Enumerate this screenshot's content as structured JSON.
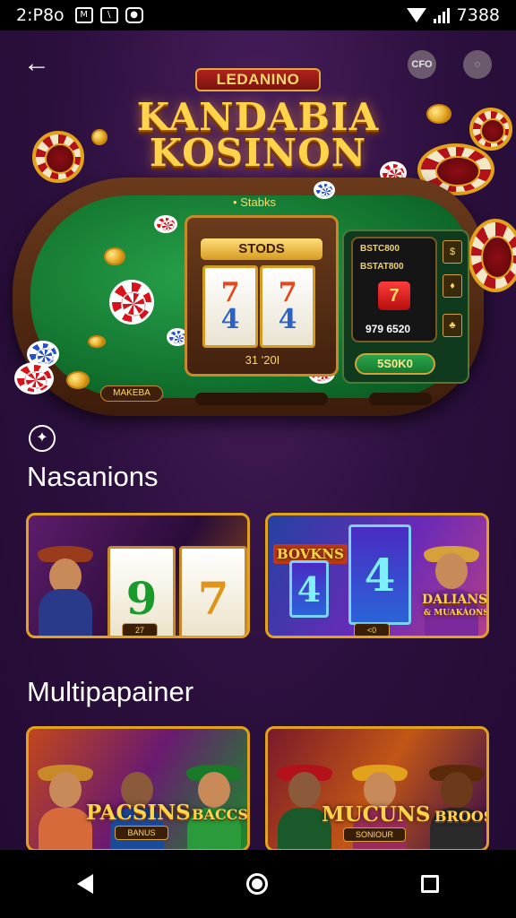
{
  "status_bar": {
    "time": "2:P8o",
    "icon_1": "M",
    "battery_text": "7388",
    "icons": [
      "msg-icon",
      "sim-icon",
      "camera-icon",
      "wifi-icon",
      "signal-icon"
    ]
  },
  "header": {
    "back_icon": "←",
    "top_button_1": "CFO",
    "top_button_2": "◌",
    "brand_subtitle": "LEDANINO",
    "brand_title_line1": "KANDABIA",
    "brand_title_line2": "KOSINON"
  },
  "table": {
    "felt_label": "• Stabks",
    "slot_header": "STODS",
    "reel_1": [
      "7",
      "4"
    ],
    "reel_2": [
      "7",
      "4"
    ],
    "slot_footer": "31 '20I",
    "panel_line1": "BSTC800",
    "panel_line2": "BSTAT800",
    "panel_bet": "7",
    "panel_value": "979 6520",
    "panel_symbols": [
      "$",
      "♦",
      "♣"
    ],
    "panel_balance": "5S0K0",
    "rail_badge": "MAKEBA"
  },
  "sections": [
    {
      "icon": "✦",
      "title": "Nasanions",
      "cards": [
        {
          "reel_a": "9",
          "reel_b": "7",
          "badge": "27"
        },
        {
          "label_left": "BOVKNS",
          "reel_a": "4",
          "reel_b": "4",
          "label_right": "DALIANS",
          "label_right_sub": "& MUAKÁONS",
          "badge": "<0"
        }
      ]
    },
    {
      "title": "Multipapainer",
      "cards": [
        {
          "label": "PACSINS",
          "label_extra": "BACCS",
          "sub": "BANUS"
        },
        {
          "label": "MUCUNS",
          "label_extra": "BROOS",
          "sub": "SONIOUR"
        }
      ]
    }
  ],
  "colors": {
    "background": "#2a0f3a",
    "gold": "#e3a21c",
    "felt_green": "#0f6b2a",
    "chip_red": "#d8111b"
  }
}
